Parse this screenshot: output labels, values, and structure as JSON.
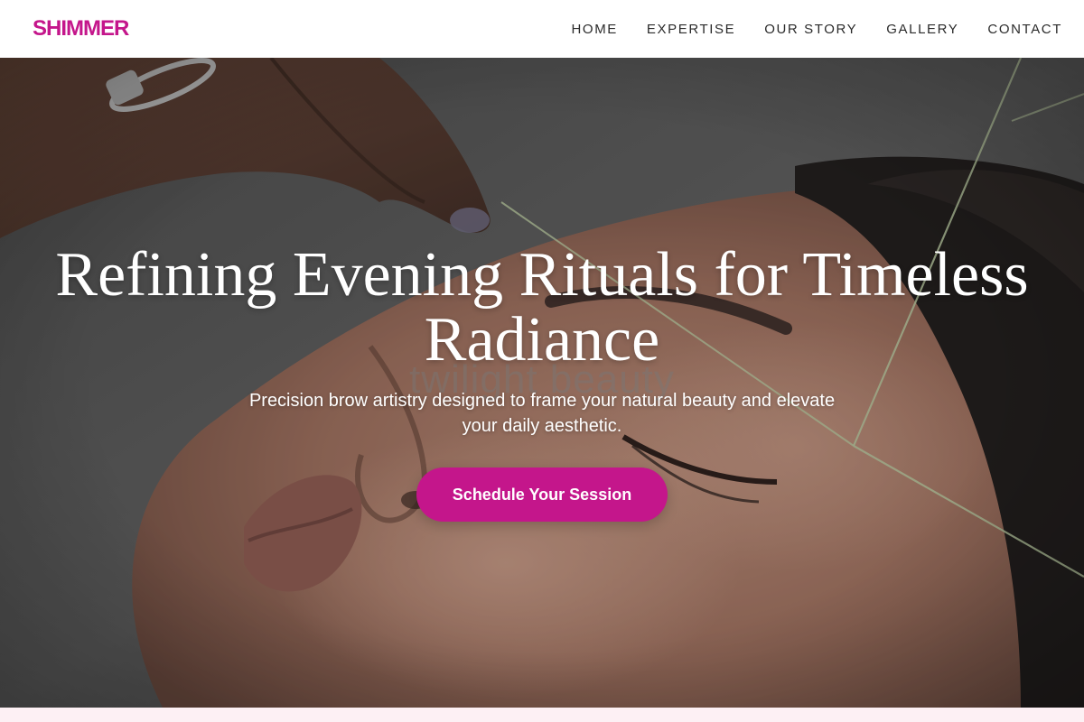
{
  "brand": {
    "name": "SHIMMER",
    "color": "#c4168b"
  },
  "nav": {
    "items": [
      {
        "label": "HOME"
      },
      {
        "label": "EXPERTISE"
      },
      {
        "label": "OUR STORY"
      },
      {
        "label": "GALLERY"
      },
      {
        "label": "CONTACT"
      }
    ]
  },
  "hero": {
    "title": "Refining Evening Rituals for Timeless Radiance",
    "watermark": "twilight beauty",
    "subtitle": "Precision brow artistry designed to frame your natural beauty and elevate your daily aesthetic.",
    "cta_label": "Schedule Your Session",
    "cta_color": "#c4168b",
    "image_subject": "brow-threading-photo"
  },
  "colors": {
    "accent": "#c4168b",
    "band": "#fdf0f4",
    "nav_text": "#2b2b2b"
  }
}
